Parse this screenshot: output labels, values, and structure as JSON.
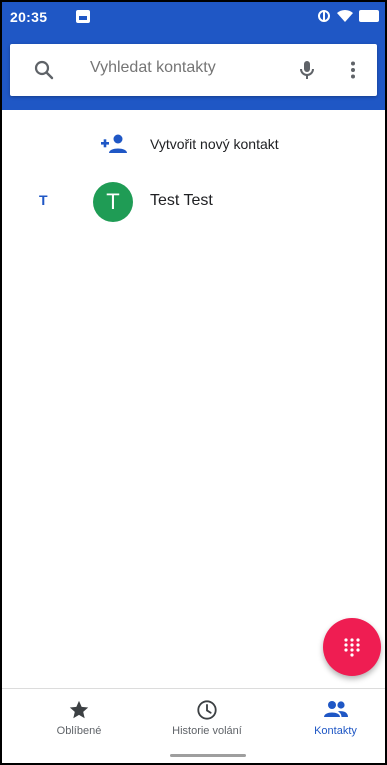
{
  "status_bar": {
    "time": "20:35"
  },
  "search": {
    "placeholder": "Vyhledat kontakty"
  },
  "create_contact": {
    "label": "Vytvořit nový kontakt"
  },
  "contacts": [
    {
      "section_letter": "T",
      "avatar_letter": "T",
      "name": "Test Test",
      "avatar_color": "#1f9c55"
    }
  ],
  "bottom_nav": {
    "favorites_label": "Oblíbené",
    "history_label": "Historie volání",
    "contacts_label": "Kontakty"
  },
  "colors": {
    "primary": "#1f57c5",
    "fab": "#ef1d52",
    "avatar": "#1f9c55"
  },
  "icons": {
    "search": "search-icon",
    "mic": "mic-icon",
    "more": "more-vert-icon",
    "add_person": "person-add-icon",
    "dialpad": "dialpad-icon",
    "star": "star-icon",
    "clock": "clock-icon",
    "people": "people-icon"
  }
}
